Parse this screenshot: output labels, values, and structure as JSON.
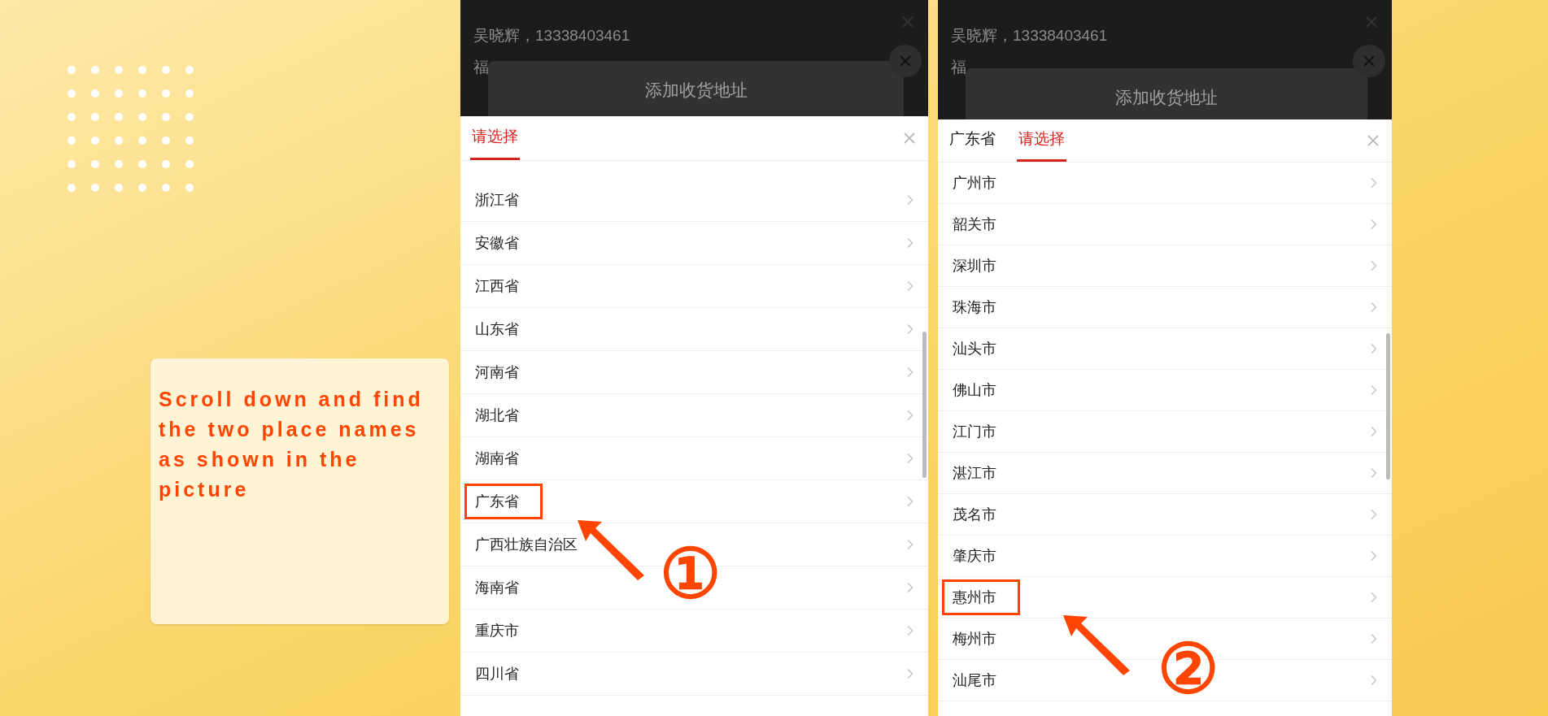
{
  "instruction_card": {
    "text": "Scroll down and find the two place names as shown in the picture"
  },
  "panels": [
    {
      "contact": "吴晓辉，13338403461",
      "address": "福",
      "modal_title": "添加收货地址",
      "tabs": [
        {
          "label": "请选择",
          "selected": true
        }
      ],
      "items": [
        {
          "label": "浙江省",
          "highlighted": false
        },
        {
          "label": "安徽省",
          "highlighted": false
        },
        {
          "label": "江西省",
          "highlighted": false
        },
        {
          "label": "山东省",
          "highlighted": false
        },
        {
          "label": "河南省",
          "highlighted": false
        },
        {
          "label": "湖北省",
          "highlighted": false
        },
        {
          "label": "湖南省",
          "highlighted": false
        },
        {
          "label": "广东省",
          "highlighted": true
        },
        {
          "label": "广西壮族自治区",
          "highlighted": false
        },
        {
          "label": "海南省",
          "highlighted": false
        },
        {
          "label": "重庆市",
          "highlighted": false
        },
        {
          "label": "四川省",
          "highlighted": false
        }
      ],
      "step": "①"
    },
    {
      "contact": "吴晓辉，13338403461",
      "address": "福",
      "modal_title": "添加收货地址",
      "tabs": [
        {
          "label": "广东省",
          "selected": false
        },
        {
          "label": "请选择",
          "selected": true
        }
      ],
      "items": [
        {
          "label": "广州市",
          "highlighted": false
        },
        {
          "label": "韶关市",
          "highlighted": false
        },
        {
          "label": "深圳市",
          "highlighted": false
        },
        {
          "label": "珠海市",
          "highlighted": false
        },
        {
          "label": "汕头市",
          "highlighted": false
        },
        {
          "label": "佛山市",
          "highlighted": false
        },
        {
          "label": "江门市",
          "highlighted": false
        },
        {
          "label": "湛江市",
          "highlighted": false
        },
        {
          "label": "茂名市",
          "highlighted": false
        },
        {
          "label": "肇庆市",
          "highlighted": false
        },
        {
          "label": "惠州市",
          "highlighted": true
        },
        {
          "label": "梅州市",
          "highlighted": false
        },
        {
          "label": "汕尾市",
          "highlighted": false
        }
      ],
      "step": "②"
    }
  ]
}
